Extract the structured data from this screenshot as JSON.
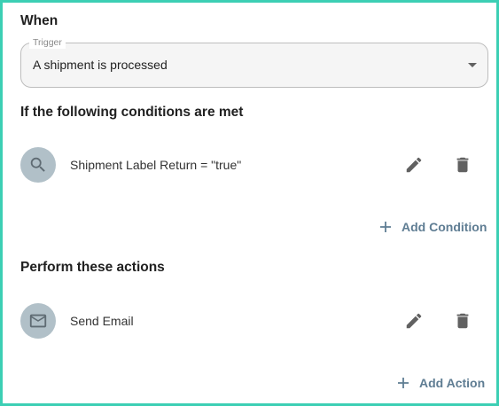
{
  "when": {
    "title": "When",
    "trigger": {
      "legend": "Trigger",
      "value": "A shipment is processed"
    }
  },
  "conditions": {
    "title": "If the following conditions are met",
    "items": [
      {
        "label": "Shipment Label Return = \"true\"",
        "icon": "search-icon"
      }
    ],
    "add_label": "Add Condition"
  },
  "actions": {
    "title": "Perform these actions",
    "items": [
      {
        "label": "Send Email",
        "icon": "email-icon"
      }
    ],
    "add_label": "Add Action"
  },
  "colors": {
    "frame": "#3ccfb4",
    "avatar_bg": "#b1c0c8",
    "link": "#5f7d93",
    "icon": "#616161"
  }
}
